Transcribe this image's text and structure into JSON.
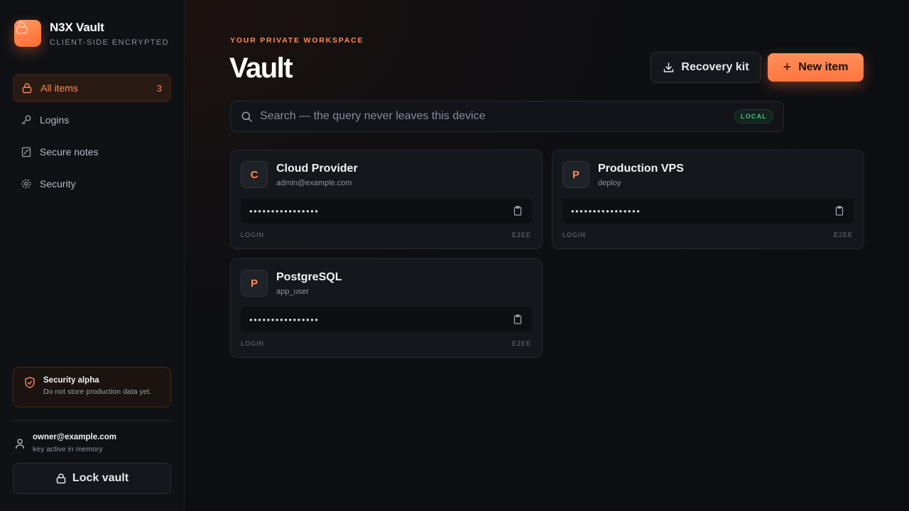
{
  "app": {
    "name": "N3X Vault",
    "subtitle": "CLIENT-SIDE ENCRYPTED"
  },
  "sidebar": {
    "items": [
      {
        "label": "All items",
        "icon": "lock-icon",
        "count": "3",
        "active": true
      },
      {
        "label": "Logins",
        "icon": "key-icon"
      },
      {
        "label": "Secure notes",
        "icon": "note-icon"
      },
      {
        "label": "Security",
        "icon": "gear-icon"
      }
    ],
    "alert": {
      "title": "Security alpha",
      "desc": "Do not store production data yet."
    },
    "user": {
      "email": "owner@example.com",
      "status": "key active in memory"
    },
    "lock_label": "Lock vault"
  },
  "header": {
    "eyebrow": "YOUR PRIVATE WORKSPACE",
    "title": "Vault",
    "recovery_label": "Recovery kit",
    "new_label": "New item"
  },
  "search": {
    "placeholder": "Search — the query never leaves this device",
    "badge": "LOCAL"
  },
  "items": [
    {
      "initial": "C",
      "name": "Cloud Provider",
      "username": "admin@example.com",
      "secret": "••••••••••••••••",
      "type": "LOGIN",
      "enc": "E2EE"
    },
    {
      "initial": "P",
      "name": "Production VPS",
      "username": "deploy",
      "secret": "••••••••••••••••",
      "type": "LOGIN",
      "enc": "E2EE"
    },
    {
      "initial": "P",
      "name": "PostgreSQL",
      "username": "app_user",
      "secret": "••••••••••••••••",
      "type": "LOGIN",
      "enc": "E2EE"
    }
  ],
  "colors": {
    "accent": "#ff7a45",
    "success": "#3fc38a",
    "background": "#0c0e12"
  }
}
